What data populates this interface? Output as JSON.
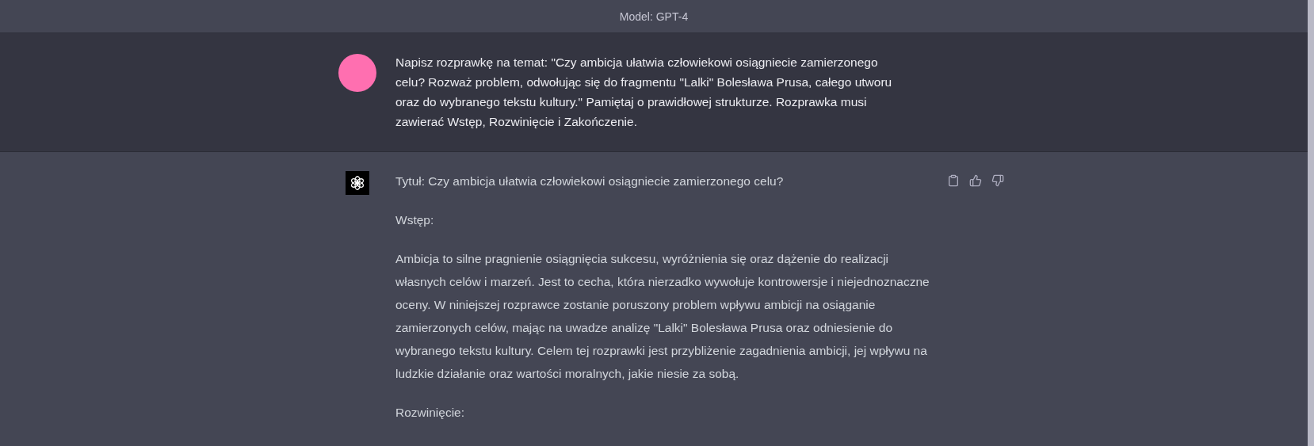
{
  "header": {
    "model_label": "Model: GPT-4"
  },
  "messages": [
    {
      "kind": "user",
      "color": "#ff6fb0",
      "paragraphs": [
        "Napisz rozprawkę na temat: \"Czy ambicja ułatwia człowiekowi osiągniecie zamierzonego celu? Rozważ problem, odwołując się do fragmentu \"Lalki\" Bolesława Prusa, całego utworu oraz do wybranego tekstu kultury.\" Pamiętaj o prawidłowej strukturze. Rozprawka musi zawierać Wstęp, Rozwinięcie i Zakończenie."
      ]
    },
    {
      "kind": "assistant",
      "paragraphs": [
        "Tytuł: Czy ambicja ułatwia człowiekowi osiągniecie zamierzonego celu?",
        "Wstęp:",
        "Ambicja to silne pragnienie osiągnięcia sukcesu, wyróżnienia się oraz dążenie do realizacji własnych celów i marzeń. Jest to cecha, która nierzadko wywołuje kontrowersje i niejednoznaczne oceny. W niniejszej rozprawce zostanie poruszony problem wpływu ambicji na osiąganie zamierzonych celów, mając na uwadze analizę \"Lalki\" Bolesława Prusa oraz odniesienie do wybranego tekstu kultury. Celem tej rozprawki jest przybliżenie zagadnienia ambicji, jej wpływu na ludzkie działanie oraz wartości moralnych, jakie niesie za sobą.",
        "Rozwinięcie:"
      ]
    }
  ]
}
